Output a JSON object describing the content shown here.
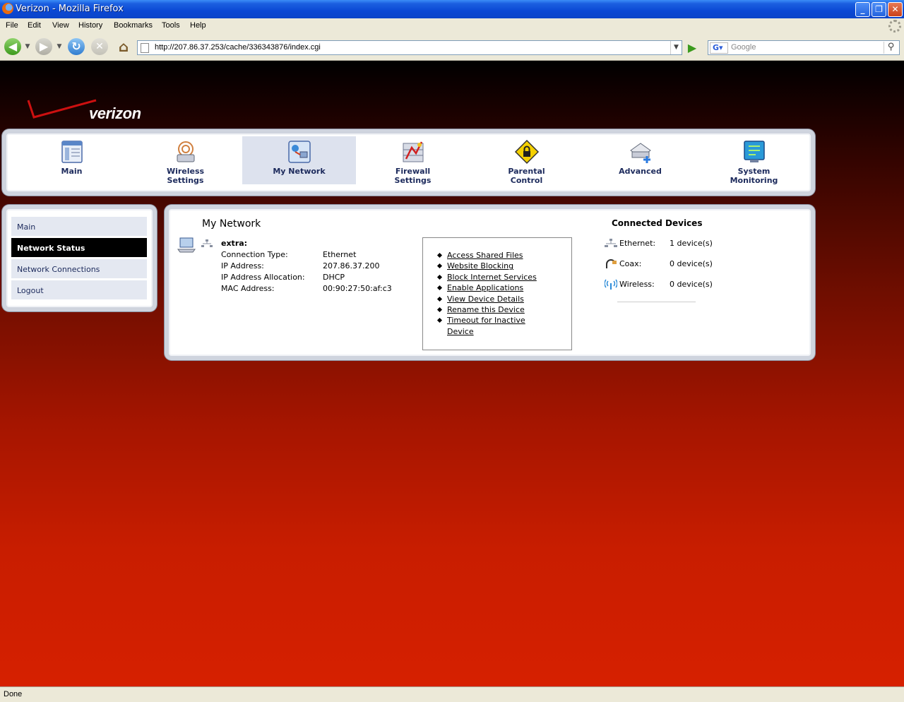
{
  "window": {
    "title": "Verizon - Mozilla Firefox"
  },
  "menu": [
    "File",
    "Edit",
    "View",
    "History",
    "Bookmarks",
    "Tools",
    "Help"
  ],
  "navbar": {
    "url": "http://207.86.37.253/cache/336343876/index.cgi",
    "search_placeholder": "Google"
  },
  "status": "Done",
  "brand": {
    "name": "verizon"
  },
  "topnav": [
    {
      "label": "Main",
      "icon": "main-icon"
    },
    {
      "label": "Wireless\nSettings",
      "icon": "wireless-settings-icon"
    },
    {
      "label": "My Network",
      "icon": "my-network-icon",
      "active": true
    },
    {
      "label": "Firewall\nSettings",
      "icon": "firewall-settings-icon"
    },
    {
      "label": "Parental\nControl",
      "icon": "parental-control-icon"
    },
    {
      "label": "Advanced",
      "icon": "advanced-icon"
    },
    {
      "label": "System\nMonitoring",
      "icon": "system-monitoring-icon"
    }
  ],
  "sidenav": [
    {
      "label": "Main"
    },
    {
      "label": "Network Status",
      "active": true
    },
    {
      "label": "Network Connections"
    },
    {
      "label": "Logout"
    }
  ],
  "main": {
    "heading": "My Network",
    "device": {
      "name": "extra:",
      "fields": [
        {
          "key": "Connection Type:",
          "value": "Ethernet"
        },
        {
          "key": "IP Address:",
          "value": "207.86.37.200"
        },
        {
          "key": "IP Address Allocation:",
          "value": "DHCP"
        },
        {
          "key": "MAC Address:",
          "value": "00:90:27:50:af:c3"
        }
      ]
    },
    "actions": [
      "Access Shared Files",
      "Website Blocking",
      "Block Internet Services",
      "Enable Applications",
      "View Device Details",
      "Rename this Device",
      "Timeout for Inactive Device"
    ],
    "connected": {
      "title": "Connected Devices",
      "rows": [
        {
          "label": "Ethernet:",
          "value": "1 device(s)",
          "icon": "ethernet-icon"
        },
        {
          "label": "Coax:",
          "value": "0 device(s)",
          "icon": "coax-icon"
        },
        {
          "label": "Wireless:",
          "value": "0 device(s)",
          "icon": "wireless-icon"
        }
      ]
    }
  },
  "colors": {
    "active_tab": "#dde2ee",
    "side_active": "#000000",
    "nav_text": "#1c2a5c"
  }
}
